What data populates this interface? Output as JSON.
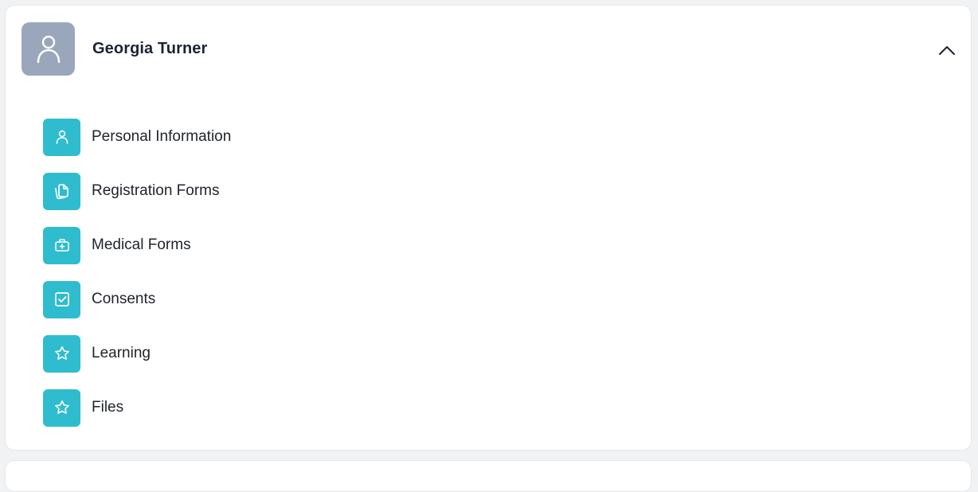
{
  "profile": {
    "name": "Georgia Turner",
    "avatar_icon": "user-icon",
    "toggle_icon": "chevron-up-icon"
  },
  "menu": {
    "items": [
      {
        "label": "Personal Information",
        "icon": "user-icon"
      },
      {
        "label": "Registration Forms",
        "icon": "documents-icon"
      },
      {
        "label": "Medical Forms",
        "icon": "medical-kit-icon"
      },
      {
        "label": "Consents",
        "icon": "checkbox-icon"
      },
      {
        "label": "Learning",
        "icon": "star-icon"
      },
      {
        "label": "Files",
        "icon": "star-icon"
      }
    ]
  },
  "colors": {
    "accent_tile": "#2fbcce",
    "avatar_bg": "#9aa6bb",
    "name_text": "#1c2433",
    "item_text": "#1f2329"
  }
}
